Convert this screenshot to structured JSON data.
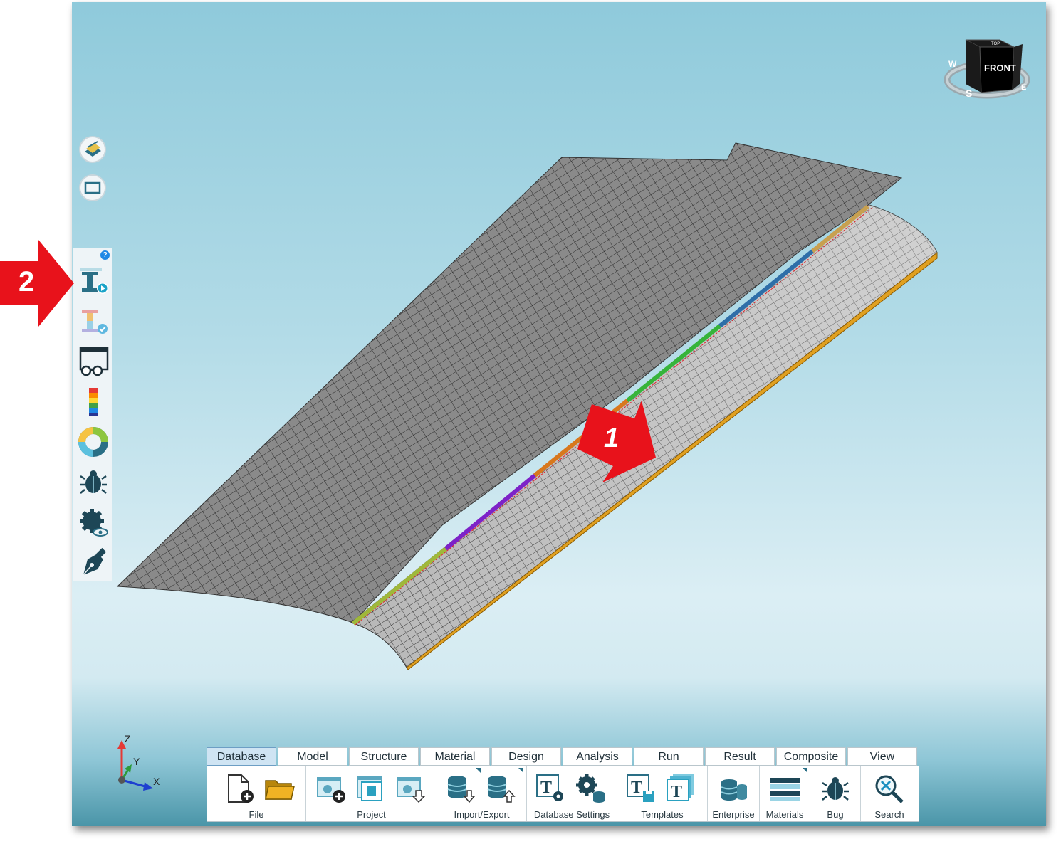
{
  "ribbon": {
    "tabs": [
      "Database",
      "Model",
      "Structure",
      "Material",
      "Design",
      "Analysis",
      "Run",
      "Result",
      "Composite",
      "View"
    ],
    "active_tab": "Database",
    "groups": {
      "file": "File",
      "project": "Project",
      "import_export": "Import/Export",
      "database_settings": "Database Settings",
      "templates": "Templates",
      "enterprise": "Enterprise",
      "materials": "Materials",
      "bug": "Bug",
      "search": "Search"
    }
  },
  "view_cube": {
    "face_front": "FRONT",
    "face_top": "TOP",
    "compass": [
      "W",
      "S",
      "E"
    ]
  },
  "axis_triad": {
    "z": "Z",
    "y": "Y",
    "x": "X"
  },
  "toolstrip": {
    "help": "?"
  },
  "callouts": {
    "one": "1",
    "two": "2"
  },
  "colors": {
    "accent_teal": "#2a6f86",
    "callout_red": "#e8121b",
    "mesh_gray": "#8c8c8c",
    "edge_orange": "#e0a020"
  }
}
